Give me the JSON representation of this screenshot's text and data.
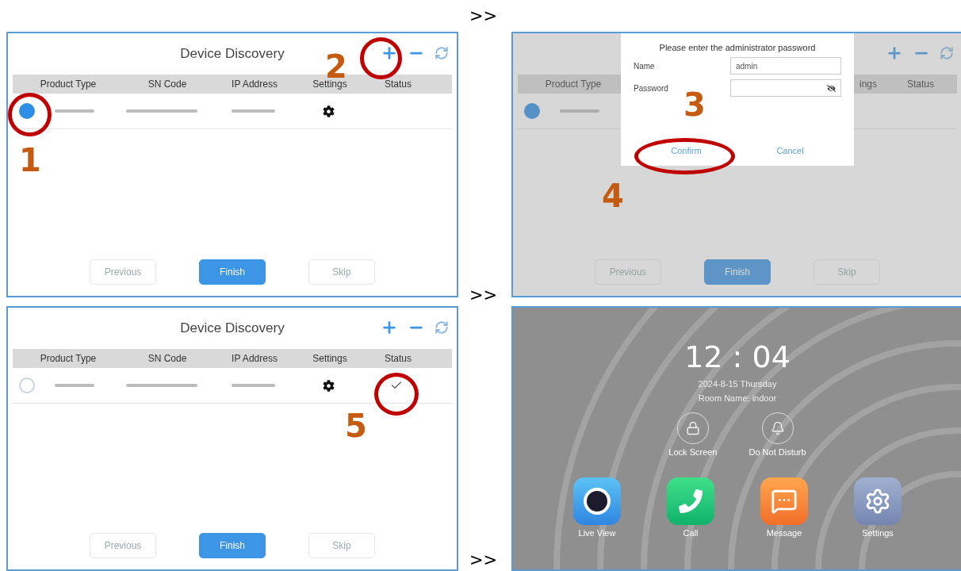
{
  "arrows": [
    ">>",
    ">>",
    ">>"
  ],
  "panels": [
    {
      "kind": "discovery",
      "title": "Device Discovery",
      "columns": [
        "Product Type",
        "SN Code",
        "IP Address",
        "Settings",
        "Status"
      ],
      "device": {
        "selected": true,
        "added": false
      },
      "buttons": [
        {
          "label": "Previous",
          "primary": false
        },
        {
          "label": "Finish",
          "primary": true
        },
        {
          "label": "Skip",
          "primary": false
        }
      ],
      "marks": [
        "1",
        "2"
      ]
    },
    {
      "kind": "password",
      "columns": [
        "Product Type",
        "ings",
        "Status"
      ],
      "device": {
        "selected": true
      },
      "dialog": {
        "title": "Please enter the administrator password",
        "fields": [
          {
            "label": "Name",
            "value": "admin",
            "kind": "text"
          },
          {
            "label": "Password",
            "kind": "password"
          }
        ],
        "buttons": [
          "Confirm",
          "Cancel"
        ]
      },
      "buttons": [
        {
          "label": "Previous",
          "primary": false
        },
        {
          "label": "Finish",
          "primary": true
        },
        {
          "label": "Skip",
          "primary": false
        }
      ],
      "marks": [
        "3",
        "4"
      ]
    },
    {
      "kind": "discovery",
      "title": "Device Discovery",
      "columns": [
        "Product Type",
        "SN Code",
        "IP Address",
        "Settings",
        "Status"
      ],
      "device": {
        "selected": false,
        "added": true
      },
      "buttons": [
        {
          "label": "Previous",
          "primary": false
        },
        {
          "label": "Finish",
          "primary": true
        },
        {
          "label": "Skip",
          "primary": false
        }
      ],
      "marks": [
        "5"
      ]
    },
    {
      "kind": "home",
      "time": "12 : 04",
      "date": "2024-8-15 Thursday",
      "room": "Room Name: indoor",
      "quick": [
        {
          "label": "Lock Screen",
          "kind": "lock"
        },
        {
          "label": "Do Not Disturb",
          "kind": "bell"
        }
      ],
      "apps": [
        {
          "label": "Live View",
          "kind": "camera"
        },
        {
          "label": "Call",
          "kind": "phone"
        },
        {
          "label": "Message",
          "kind": "chat"
        },
        {
          "label": "Settings",
          "kind": "gear"
        }
      ]
    }
  ]
}
